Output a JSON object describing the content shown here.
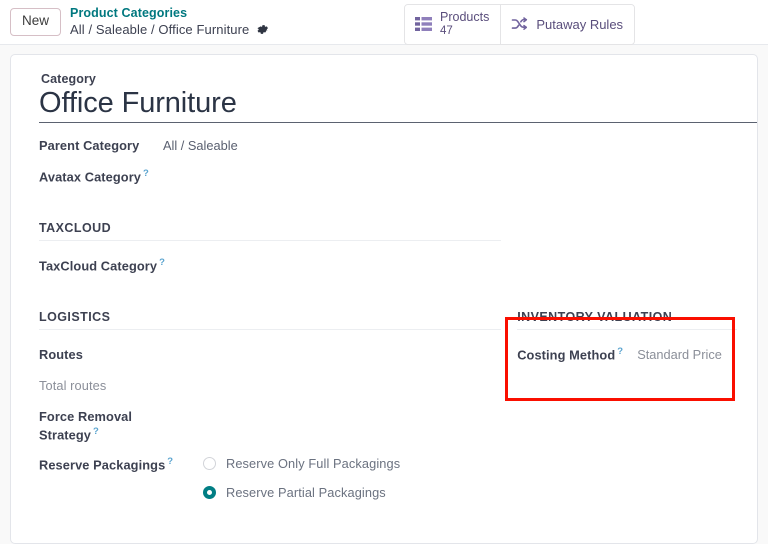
{
  "control_panel": {
    "new_button": "New",
    "breadcrumb_root": "Product Categories",
    "breadcrumb_path": "All / Saleable / Office Furniture",
    "gear_icon": "gear-icon"
  },
  "stat_buttons": [
    {
      "icon": "list-view-icon",
      "label": "Products",
      "value": "47"
    },
    {
      "icon": "shuffle-icon",
      "label": "Putaway Rules"
    }
  ],
  "form": {
    "title_caption": "Category",
    "title_value": "Office Furniture",
    "fields": [
      {
        "label": "Parent Category",
        "value": "All / Saleable",
        "tooltip": false
      },
      {
        "label": "Avatax Category",
        "value": "",
        "tooltip": true
      }
    ],
    "taxcloud": {
      "section_title": "TAXCLOUD",
      "field_label": "TaxCloud Category",
      "field_value": "",
      "tooltip": true
    },
    "logistics": {
      "section_title": "LOGISTICS",
      "routes_label": "Routes",
      "routes_value": "",
      "total_routes_label": "Total routes",
      "total_routes_value": "",
      "force_removal_label": "Force Removal Strategy",
      "force_removal_value": "",
      "reserve_label": "Reserve Packagings",
      "reserve_options": [
        {
          "text": "Reserve Only Full Packagings",
          "selected": false
        },
        {
          "text": "Reserve Partial Packagings",
          "selected": true
        }
      ]
    },
    "inventory_valuation": {
      "section_title": "INVENTORY VALUATION",
      "costing_label": "Costing Method",
      "costing_value": "Standard Price",
      "tooltip": true
    }
  },
  "annotation": {
    "highlight_color": "#fa0f00",
    "target": "inventory-valuation-section"
  },
  "colors": {
    "brand_teal": "#00787f",
    "stat_purple": "#71639e",
    "radio_selected": "#017e84",
    "tooltip_blue": "#5ba4cf"
  }
}
